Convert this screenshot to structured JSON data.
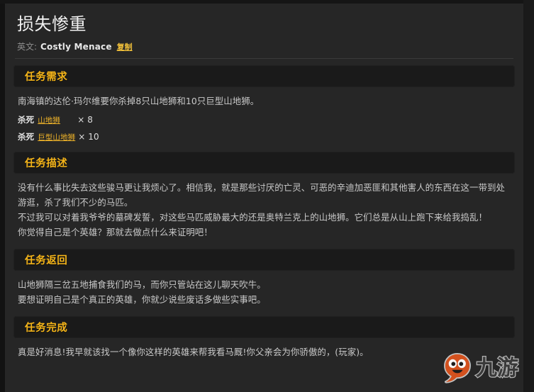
{
  "page": {
    "title": "损失惨重",
    "english_label": "英文:",
    "english_name": "Costly Menace",
    "copy_label": "复制"
  },
  "sections": [
    {
      "id": "requirements",
      "heading": "任务需求",
      "intro": "南海镇的达伦·玛尔维要你杀掉8只山地狮和10只巨型山地狮。",
      "objectives": [
        {
          "verb": "杀死",
          "target": "山地狮",
          "count": "× 8"
        },
        {
          "verb": "杀死",
          "target": "巨型山地狮",
          "count": "× 10"
        }
      ]
    },
    {
      "id": "description",
      "heading": "任务描述",
      "paragraphs": [
        "没有什么事比失去这些骏马更让我烦心了。相信我，就是那些讨厌的亡灵、可恶的辛迪加恶匪和其他害人的东西在这一带到处游逛，杀了我们不少的马匹。",
        "不过我可以对着我爷爷的墓碑发誓，对这些马匹威胁最大的还是奥特兰克上的山地狮。它们总是从山上跑下来给我捣乱！",
        "你觉得自己是个英雄？那就去做点什么来证明吧！"
      ]
    },
    {
      "id": "return",
      "heading": "任务返回",
      "paragraphs": [
        "山地狮隔三岔五地捕食我们的马，而你只管站在这儿聊天吹牛。",
        "要想证明自己是个真正的英雄，你就少说些废话多做些实事吧。"
      ]
    },
    {
      "id": "complete",
      "heading": "任务完成",
      "paragraphs": [
        "真是好消息!我早就该找一个像你这样的英雄来帮我看马厩!你父亲会为你骄傲的，(玩家)。"
      ]
    }
  ],
  "watermark": {
    "text": "九游",
    "mascot_color": "#d9531e"
  },
  "colors": {
    "accent": "#f5b51a",
    "link": "#f0b429",
    "background": "#262626",
    "section_header_bg": "#1a1a1a"
  }
}
